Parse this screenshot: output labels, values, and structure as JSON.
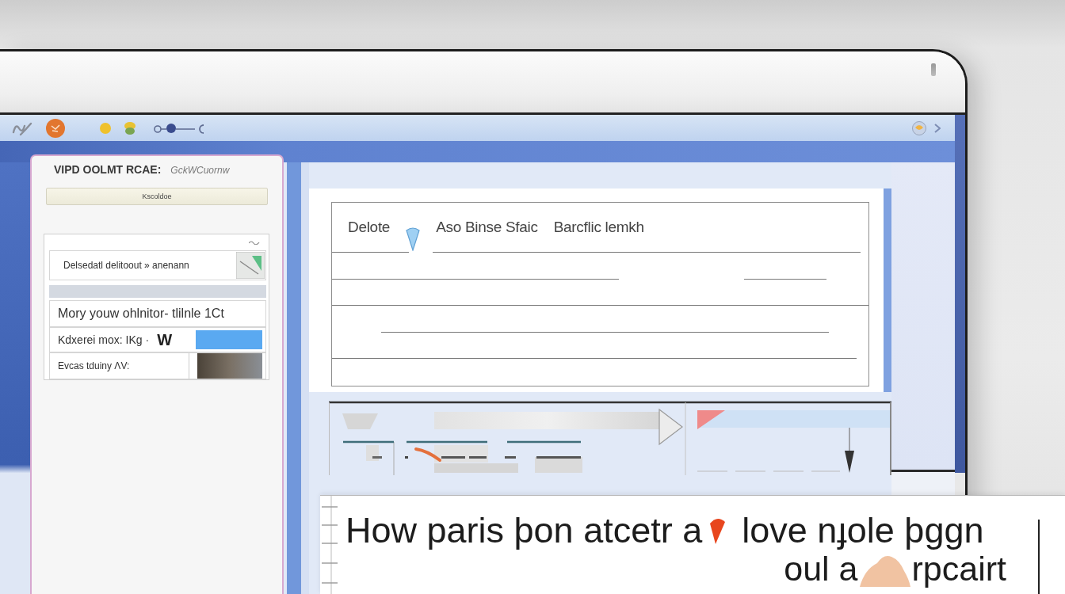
{
  "panel": {
    "title": "VIPD OOLMT RCAE:",
    "subtitle": "GckWCuornw",
    "button": "Kscoldoe",
    "items": [
      {
        "kind": "thumb",
        "label": "Delsedatl delitoout » anenann"
      },
      {
        "kind": "band"
      },
      {
        "kind": "text",
        "label": "Mory youw ohlnitor- tlilnle 1Ct"
      },
      {
        "kind": "bar",
        "label": "Kdxerei mox: IKg ·",
        "mark": "W"
      },
      {
        "kind": "photo",
        "label": "Evcas tduiny ΛV:"
      }
    ]
  },
  "document": {
    "headings": [
      "Delote",
      "Aso Binse Sfaic",
      "Barcflic lemkh"
    ]
  },
  "caption": {
    "line_1": [
      "How paris þon atcetr a",
      "love nɟole þggn"
    ],
    "line_2": [
      "oul a",
      "rpcairt"
    ]
  }
}
